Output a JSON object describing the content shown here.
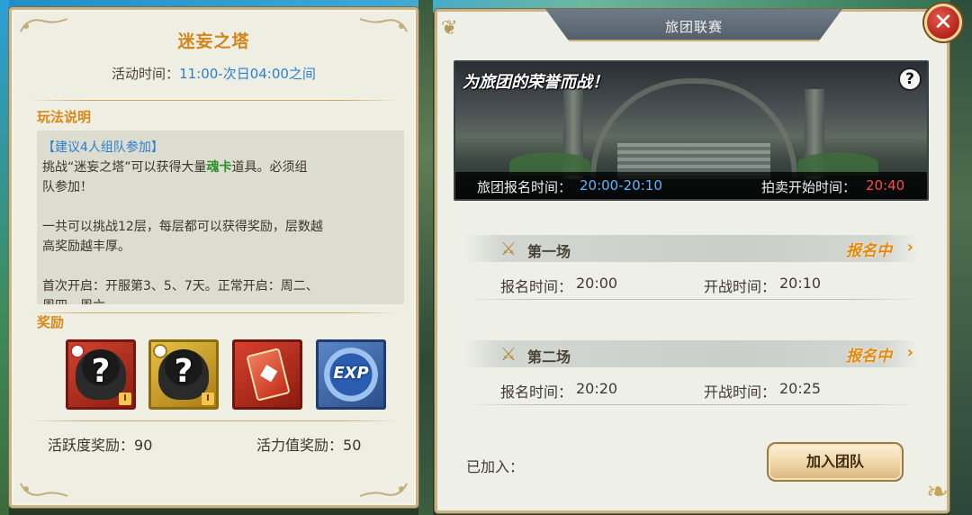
{
  "left": {
    "title": "迷妄之塔",
    "time_label": "活动时间：",
    "time_value": "11:00-次日04:00之间",
    "howto_title": "玩法说明",
    "team_hint": "【建议4人组队参加】",
    "desc_1a": "挑战“迷妄之塔”可以获得大量",
    "desc_1b": "魂卡",
    "desc_1c": "道具。必须组",
    "desc_1d": "队参加！",
    "desc_2a": "一共可以挑战12层，每层都可以获得奖励，层数越",
    "desc_2b": "高奖励越丰厚。",
    "desc_3a": "首次开启：开服第3、5、7天。正常开启：周二、",
    "desc_3b": "周四、周六",
    "reward_title": "奖励",
    "rewards": [
      {
        "icon": "unknown-soul-card-red-icon",
        "text": "?",
        "badge": "I"
      },
      {
        "icon": "unknown-soul-card-gold-icon",
        "text": "?",
        "badge": "I"
      },
      {
        "icon": "red-card-icon",
        "text": "",
        "badge": ""
      },
      {
        "icon": "exp-orb-icon",
        "text": "EXP",
        "badge": ""
      }
    ],
    "activity_reward_label": "活跃度奖励：",
    "activity_reward_value": "90",
    "vitality_reward_label": "活力值奖励：",
    "vitality_reward_value": "50"
  },
  "right": {
    "title": "旅团联赛",
    "banner_slogan": "为旅团的荣誉而战！",
    "help_icon": "?",
    "signup_label": "旅团报名时间：",
    "signup_value": "20:00-20:10",
    "auction_label": "拍卖开始时间：",
    "auction_value": "20:40",
    "matches": [
      {
        "name": "第一场",
        "status": "报名中",
        "signup_label": "报名时间：",
        "signup_value": "20:00",
        "start_label": "开战时间：",
        "start_value": "20:10"
      },
      {
        "name": "第二场",
        "status": "报名中",
        "signup_label": "报名时间：",
        "signup_value": "20:20",
        "start_label": "开战时间：",
        "start_value": "20:25"
      }
    ],
    "joined_label": "已加入：",
    "join_button": "加入团队"
  },
  "close_button": "✕",
  "colors": {
    "title_orange": "#d2851b",
    "time_blue": "#2a7fd1",
    "highlight_green": "#2b8f2b",
    "status_orange": "#e28a12",
    "auction_red": "#ff4a4a",
    "signup_blue": "#5fb3ff"
  }
}
